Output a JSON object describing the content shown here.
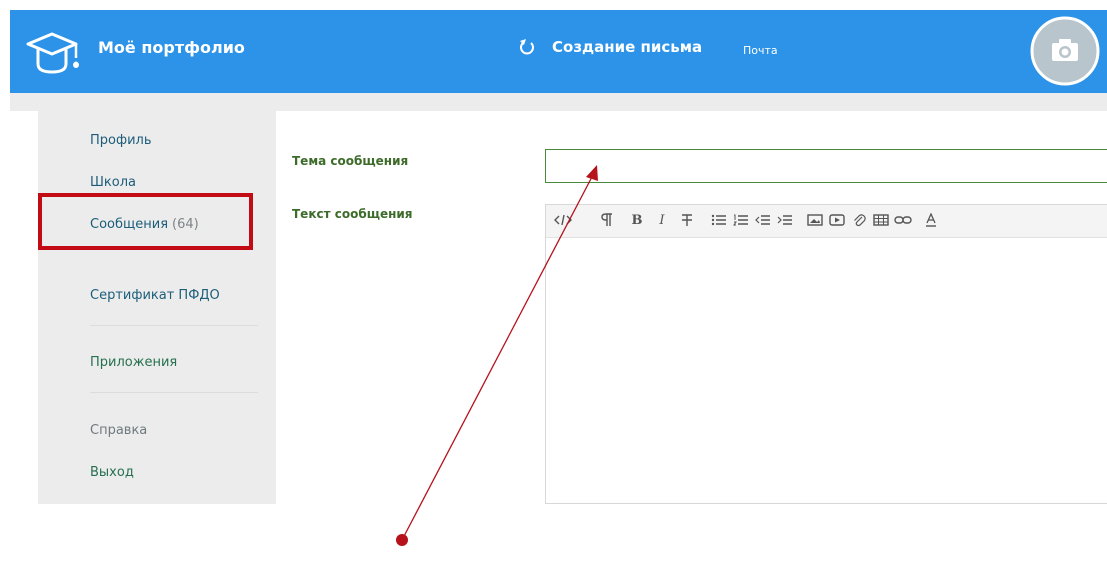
{
  "header": {
    "app_title": "Моё портфолио",
    "page_title": "Создание письма",
    "page_subtitle": "Почта",
    "icons": [
      "graduation-cap-icon",
      "back-icon",
      "camera-icon"
    ],
    "colors": {
      "header_bg": "#2c93e8",
      "highlight": "#c30b16",
      "annotation": "#b5121b"
    }
  },
  "sidebar": {
    "items": [
      {
        "label": "Профиль"
      },
      {
        "label": "Школа"
      },
      {
        "label": "Сообщения",
        "count": "(64)"
      },
      {
        "label": "Сертификат ПФДО"
      },
      {
        "label": "Приложения"
      },
      {
        "label": "Справка"
      },
      {
        "label": "Выход"
      }
    ]
  },
  "form": {
    "subject_label": "Тема сообщения",
    "subject_value": "",
    "text_label": "Текст сообщения",
    "toolbar": [
      "code-view",
      "paragraph",
      "bold",
      "italic",
      "strikethrough",
      "unordered-list",
      "ordered-list",
      "outdent",
      "indent",
      "image",
      "video",
      "attachment",
      "table",
      "link",
      "font-color"
    ]
  }
}
